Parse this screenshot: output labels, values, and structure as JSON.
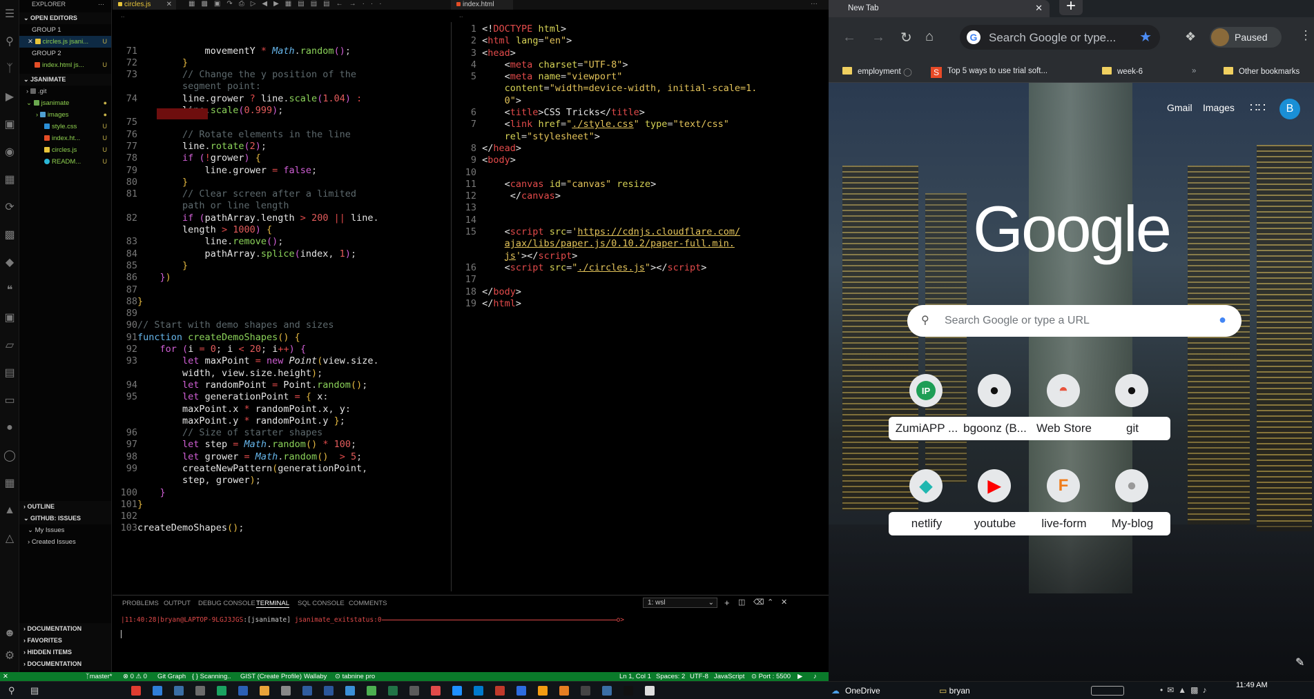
{
  "sidebar": {
    "explorer_title": "EXPLORER",
    "open_editors": "OPEN EDITORS",
    "group1": "GROUP 1",
    "group1_file": "circles.js jsani...",
    "group2": "GROUP 2",
    "group2_file": "index.html js...",
    "project": "JSANIMATE",
    "items": [
      {
        "label": ".git",
        "badge": "",
        "color": "#bbb"
      },
      {
        "label": "jsanimate",
        "badge": "●",
        "color": "#8fd14f"
      },
      {
        "label": "images",
        "badge": "●",
        "color": "#8fd14f"
      },
      {
        "label": "style.css",
        "badge": "U",
        "color": "#8fd14f"
      },
      {
        "label": "index.ht...",
        "badge": "U",
        "color": "#8fd14f"
      },
      {
        "label": "circles.js",
        "badge": "U",
        "color": "#8fd14f"
      },
      {
        "label": "READM...",
        "badge": "U",
        "color": "#8fd14f"
      }
    ],
    "outline": "OUTLINE",
    "issues": "GITHUB: ISSUES",
    "my_issues": "My Issues",
    "created_issues": "Created Issues",
    "documentation": "DOCUMENTATION",
    "favorites": "FAVORITES",
    "hidden_items": "HIDDEN ITEMS",
    "documentation2": "DOCUMENTATION"
  },
  "editor1": {
    "tab": "circles.js"
  },
  "editor2": {
    "tab": "index.html"
  },
  "panel": {
    "tabs": [
      "PROBLEMS",
      "OUTPUT",
      "DEBUG CONSOLE",
      "TERMINAL",
      "SQL CONSOLE",
      "COMMENTS"
    ],
    "terminal_select": "1: wsl",
    "prompt_time": "11:40:28",
    "prompt_user": "bryan@LAPTOP-9LGJ3JGS",
    "prompt_dir": "[jsanimate]",
    "prompt_status": "jsanimate_exitstatus:0"
  },
  "status": {
    "branch": "master*",
    "problems": "⊗ 0 ⚠ 0",
    "gitgraph": "Git Graph",
    "scanning": "{ } Scanning..",
    "gist": "GIST (Create Profile)",
    "wallaby": "Wallaby",
    "tabnine": "⊙ tabnine pro",
    "position": "Ln 1, Col 1",
    "spaces": "Spaces: 2",
    "encoding": "UTF-8",
    "language": "JavaScript",
    "port": "⊙ Port : 5500"
  },
  "browser": {
    "tab_title": "New Tab",
    "omnibox_placeholder": "Search Google or type...",
    "profile": "Paused",
    "bookmarks": [
      "employment",
      "Top 5 ways to use trial soft...",
      "week-6",
      "Other bookmarks"
    ],
    "links": [
      "Gmail",
      "Images"
    ],
    "avatar": "B",
    "logo": "Google",
    "search_placeholder": "Search Google or type a URL",
    "shortcuts": [
      {
        "label": "ZumiAPP ...",
        "icon": "IP",
        "bg": "#1e9e56",
        "fg": "#fff"
      },
      {
        "label": "bgoonz (B...",
        "icon": "●",
        "bg": "#e6e8ea",
        "fg": "#111"
      },
      {
        "label": "Web Store",
        "icon": "◓",
        "bg": "#e6e8ea",
        "fg": "#e8533c"
      },
      {
        "label": "git",
        "icon": "●",
        "bg": "#e6e8ea",
        "fg": "#111"
      },
      {
        "label": "netlify",
        "icon": "◆",
        "bg": "#e6e8ea",
        "fg": "#20b7b0"
      },
      {
        "label": "youtube",
        "icon": "▶",
        "bg": "#e6e8ea",
        "fg": "#ff0000"
      },
      {
        "label": "live-form",
        "icon": "F",
        "bg": "#e6e8ea",
        "fg": "#f07c1a"
      },
      {
        "label": "My-blog",
        "icon": "●",
        "bg": "#e6e8ea",
        "fg": "#999"
      }
    ]
  },
  "taskbar": {
    "onedrive": "OneDrive",
    "user": "bryan",
    "time": "11:49 AM"
  }
}
